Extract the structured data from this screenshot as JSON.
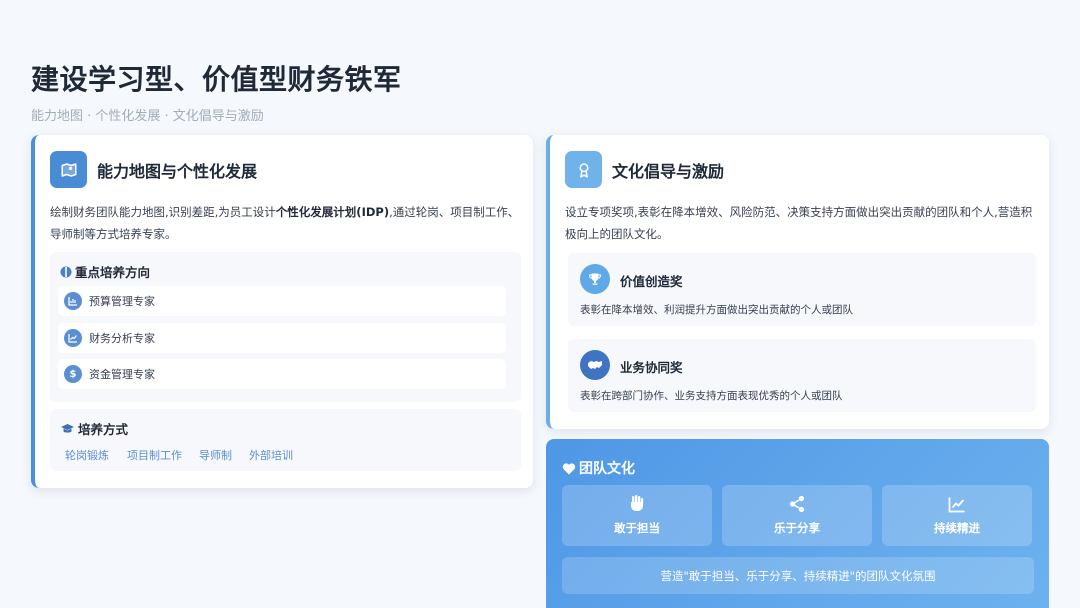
{
  "page": {
    "title": "建设学习型、价值型财务铁军",
    "subtitle": "能力地图 · 个性化发展 · 文化倡导与激励"
  },
  "capability_card": {
    "icon": "map-pin-icon",
    "title": "能力地图与个性化发展",
    "description_before": "绘制财务团队能力地图,识别差距,为员工设计",
    "description_bold": "个性化发展计划(IDP)",
    "description_after": ",通过轮岗、项目制工作、导师制等方式培养专家。",
    "focus": {
      "title": "重点培养方向",
      "items": [
        {
          "label": "预算管理专家",
          "icon": "budget-chart-icon"
        },
        {
          "label": "财务分析专家",
          "icon": "trend-line-icon"
        },
        {
          "label": "资金管理专家",
          "icon": "dollar-icon"
        }
      ]
    },
    "methods": {
      "title": "培养方式",
      "items": [
        "轮岗锻炼",
        "项目制工作",
        "导师制",
        "外部培训"
      ]
    }
  },
  "incentive_card": {
    "icon": "award-ribbon-icon",
    "title": "文化倡导与激励",
    "description": "设立专项奖项,表彰在降本增效、风险防范、决策支持方面做出突出贡献的团队和个人,营造积极向上的团队文化。",
    "awards": [
      {
        "icon": "trophy-icon",
        "title": "价值创造奖",
        "description": "表彰在降本增效、利润提升方面做出突出贡献的个人或团队"
      },
      {
        "icon": "handshake-icon",
        "title": "业务协同奖",
        "description": "表彰在跨部门协作、业务支持方面表现优秀的个人或团队"
      }
    ]
  },
  "culture": {
    "icon": "heart-icon",
    "title": "团队文化",
    "values": [
      {
        "icon": "fist-icon",
        "label": "敢于担当"
      },
      {
        "icon": "share-icon",
        "label": "乐于分享"
      },
      {
        "icon": "growth-chart-icon",
        "label": "持续精进"
      }
    ],
    "note": "营造\"敢于担当、乐于分享、持续精进\"的团队文化氛围"
  },
  "colors": {
    "accent_blue": "#4a8bd6",
    "accent_light": "#6fb3ea",
    "culture_gradient_start": "#4f97e6",
    "culture_gradient_end": "#6db2ee",
    "background": "#f5f8fc"
  }
}
